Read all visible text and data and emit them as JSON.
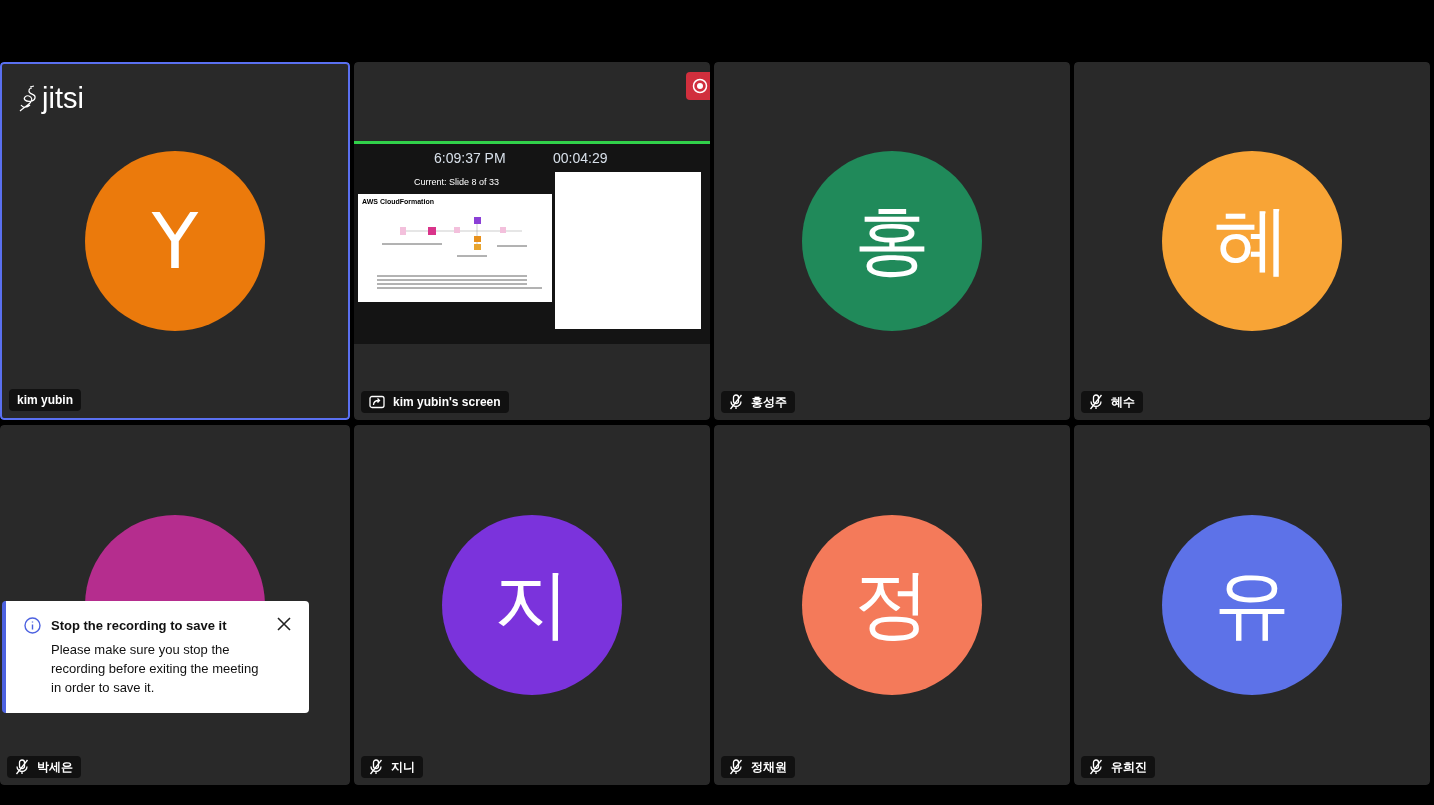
{
  "logo": "jitsi",
  "tiles": [
    {
      "kind": "avatar",
      "name": "kim yubin",
      "initial": "Y",
      "color": "#eb7a0c",
      "muted": false,
      "dominant": true
    },
    {
      "kind": "screen",
      "name": "kim yubin's screen",
      "dominant": false,
      "recording": true,
      "screen": {
        "clock": "6:09:37 PM",
        "elapsed": "00:04:29",
        "slide_label": "Current: Slide 8 of 33",
        "slide_title": "AWS CloudFormation"
      }
    },
    {
      "kind": "avatar",
      "name": "홍성주",
      "initial": "홍",
      "color": "#208a5a",
      "muted": true,
      "dominant": false
    },
    {
      "kind": "avatar",
      "name": "혜수",
      "initial": "혜",
      "color": "#f8a436",
      "muted": true,
      "dominant": false
    },
    {
      "kind": "avatar",
      "name": "박세은",
      "color": "#b52d8e",
      "muted": true,
      "dominant": false
    },
    {
      "kind": "avatar",
      "name": "지니",
      "initial": "지",
      "color": "#7b33dc",
      "muted": true,
      "dominant": false
    },
    {
      "kind": "avatar",
      "name": "정채원",
      "initial": "정",
      "color": "#f47a5a",
      "muted": true,
      "dominant": false
    },
    {
      "kind": "avatar",
      "name": "유희진",
      "initial": "유",
      "color": "#5d72e8",
      "muted": true,
      "dominant": false
    }
  ],
  "toast": {
    "title": "Stop the recording to save it",
    "message": "Please make sure you stop the recording before exiting the meeting in order to save it."
  }
}
